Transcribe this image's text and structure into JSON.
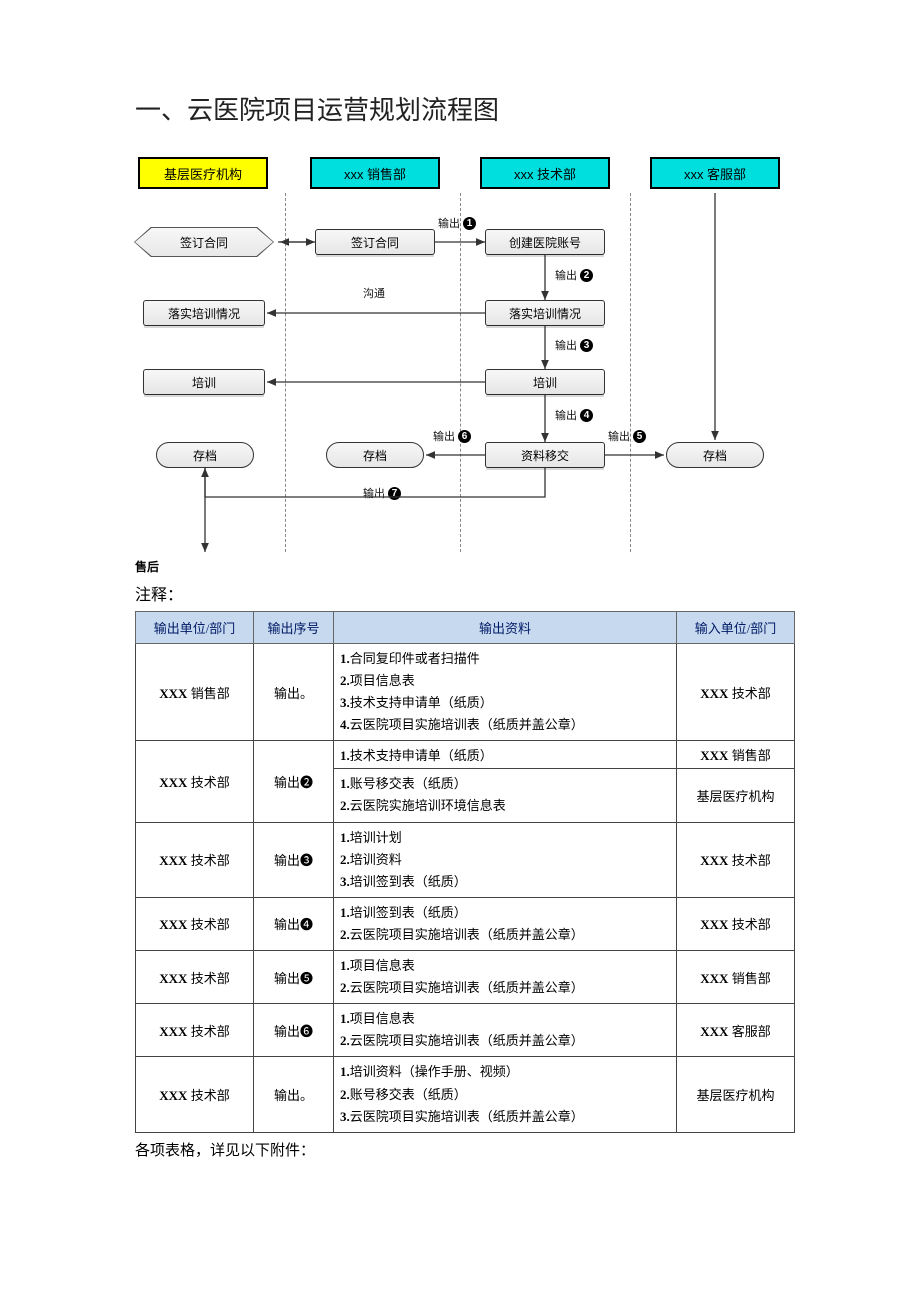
{
  "title": "一、云医院项目运营规划流程图",
  "lanes": {
    "l1": "基层医疗机构",
    "l2": "xxx 销售部",
    "l3": "xxx 技术部",
    "l4": "xxx 客服部"
  },
  "nodes": {
    "sign1": "签订合同",
    "sign2": "签订合同",
    "create_acc": "创建医院账号",
    "train_status1": "落实培训情况",
    "train_status2": "落实培训情况",
    "comm": "沟通",
    "train1": "培训",
    "train2": "培训",
    "archive1": "存档",
    "archive2": "存档",
    "handover": "资料移交",
    "archive3": "存档"
  },
  "out_label": "输出",
  "aftersale": "售后",
  "notes_title": "注释：",
  "table_headers": {
    "h1": "输出单位/部门",
    "h2": "输出序号",
    "h3": "输出资料",
    "h4": "输入单位/部门"
  },
  "rows": [
    {
      "out_dept": "XXX 销售部",
      "seq": "输出。",
      "materials": [
        "1.合同复印件或者扫描件",
        "2.项目信息表",
        "3.技术支持申请单（纸质）",
        "4.云医院项目实施培训表（纸质并盖公章）"
      ],
      "in_dept": "XXX 技术部"
    },
    {
      "out_dept": "XXX 技术部",
      "seq": "输出❷",
      "materials": [
        "1.技术支持申请单（纸质）"
      ],
      "in_dept": "XXX 销售部"
    },
    {
      "out_dept": "",
      "seq": "",
      "materials": [
        "1.账号移交表（纸质）",
        "2.云医院实施培训环境信息表"
      ],
      "in_dept": "基层医疗机构"
    },
    {
      "out_dept": "XXX 技术部",
      "seq": "输出❸",
      "materials": [
        "1.培训计划",
        "2.培训资料",
        "3.培训签到表（纸质）"
      ],
      "in_dept": "XXX 技术部"
    },
    {
      "out_dept": "XXX 技术部",
      "seq": "输出❹",
      "materials": [
        "1.培训签到表（纸质）",
        "2.云医院项目实施培训表（纸质并盖公章）"
      ],
      "in_dept": "XXX 技术部"
    },
    {
      "out_dept": "XXX 技术部",
      "seq": "输出❺",
      "materials": [
        "1.项目信息表",
        "2.云医院项目实施培训表（纸质并盖公章）"
      ],
      "in_dept": "XXX 销售部"
    },
    {
      "out_dept": "XXX 技术部",
      "seq": "输出❻",
      "materials": [
        "1.项目信息表",
        "2.云医院项目实施培训表（纸质并盖公章）"
      ],
      "in_dept": "XXX 客服部"
    },
    {
      "out_dept": "XXX 技术部",
      "seq": "输出。",
      "materials": [
        "1.培训资料（操作手册、视频）",
        "2.账号移交表（纸质）",
        "3.云医院项目实施培训表（纸质并盖公章）"
      ],
      "in_dept": "基层医疗机构"
    }
  ],
  "footnote": "各项表格，详见以下附件："
}
